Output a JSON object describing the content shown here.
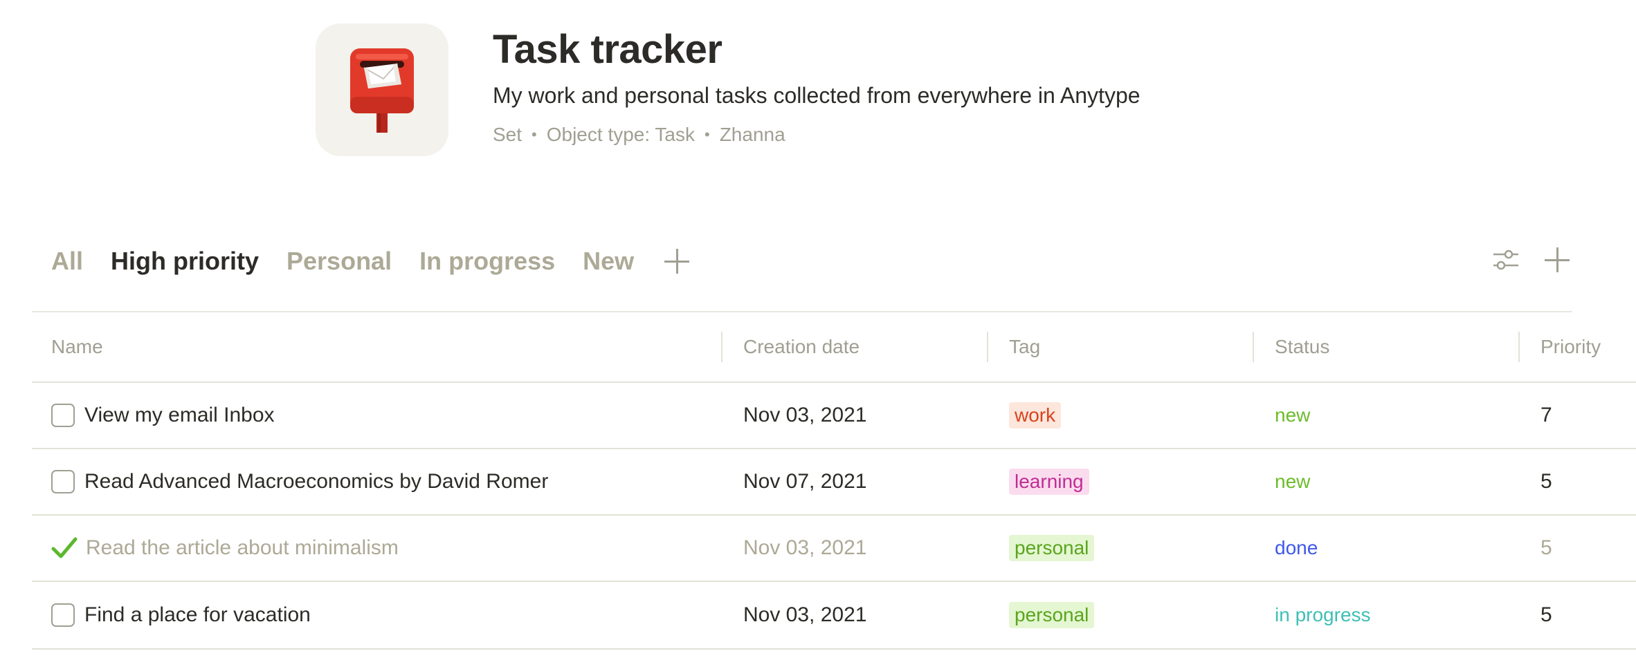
{
  "object": {
    "icon": "postbox-icon",
    "title": "Task tracker",
    "description": "My work and personal tasks collected from everywhere in Anytype",
    "meta": {
      "layout": "Set",
      "object_type": "Object type: Task",
      "author": "Zhanna"
    }
  },
  "views": {
    "tabs": [
      {
        "label": "All",
        "active": false
      },
      {
        "label": "High priority",
        "active": true
      },
      {
        "label": "Personal",
        "active": false
      },
      {
        "label": "In progress",
        "active": false
      },
      {
        "label": "New",
        "active": false
      }
    ],
    "add_view_icon": "plus-icon",
    "settings_icon": "sliders-icon",
    "add_record_icon": "plus-icon"
  },
  "table": {
    "columns": [
      "Name",
      "Creation date",
      "Tag",
      "Status",
      "Priority"
    ],
    "rows": [
      {
        "name": "View my email Inbox",
        "done": false,
        "date": "Nov 03, 2021",
        "tag": "work",
        "status": "new",
        "priority": "7"
      },
      {
        "name": "Read Advanced Macroeconomics by David Romer",
        "done": false,
        "date": "Nov 07, 2021",
        "tag": "learning",
        "status": "new",
        "priority": "5"
      },
      {
        "name": "Read the article about minimalism",
        "done": true,
        "date": "Nov 03, 2021",
        "tag": "personal",
        "status": "done",
        "priority": "5"
      },
      {
        "name": "Find a place for vacation",
        "done": false,
        "date": "Nov 03, 2021",
        "tag": "personal",
        "status": "in progress",
        "priority": "5"
      }
    ]
  },
  "colors": {
    "tag_work_bg": "#fde6dc",
    "tag_work_fg": "#d6451e",
    "tag_learning_bg": "#fbdcee",
    "tag_learning_fg": "#c02d94",
    "tag_personal_bg": "#e4f6d2",
    "tag_personal_fg": "#5aa51d",
    "status_new": "#6cbc2a",
    "status_done": "#3e58eb",
    "status_in_progress": "#3fbfb5",
    "check_done": "#5cb82e"
  }
}
